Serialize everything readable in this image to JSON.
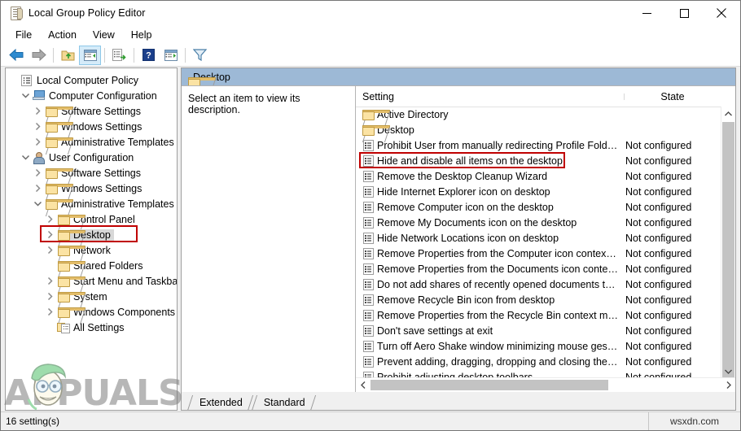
{
  "window": {
    "title": "Local Group Policy Editor",
    "icon": "policy-editor-icon",
    "controls": {
      "minimize": "—",
      "maximize": "□",
      "close": "✕"
    }
  },
  "menubar": {
    "items": [
      {
        "label": "File"
      },
      {
        "label": "Action"
      },
      {
        "label": "View"
      },
      {
        "label": "Help"
      }
    ]
  },
  "toolbar": {
    "buttons": [
      {
        "name": "back-button",
        "icon": "arrow-left-icon"
      },
      {
        "name": "forward-button",
        "icon": "arrow-right-icon"
      },
      {
        "name": "up-one-level-button",
        "icon": "folder-up-icon"
      },
      {
        "name": "show-hide-console-tree-button",
        "icon": "console-tree-icon"
      },
      {
        "name": "export-list-button",
        "icon": "export-list-icon"
      },
      {
        "name": "help-button",
        "icon": "question-mark-icon"
      },
      {
        "name": "show-hide-action-pane-button",
        "icon": "action-pane-icon"
      },
      {
        "name": "filter-button",
        "icon": "funnel-filter-icon"
      }
    ]
  },
  "tree": {
    "root": "Local Computer Policy",
    "nodes": [
      {
        "label": "Local Computer Policy",
        "indent": 0,
        "expander": "none",
        "icon": "policy-root-icon",
        "selected": false
      },
      {
        "label": "Computer Configuration",
        "indent": 1,
        "expander": "expanded",
        "icon": "computer-icon",
        "selected": false
      },
      {
        "label": "Software Settings",
        "indent": 2,
        "expander": "collapsed",
        "icon": "folder-icon",
        "selected": false
      },
      {
        "label": "Windows Settings",
        "indent": 2,
        "expander": "collapsed",
        "icon": "folder-icon",
        "selected": false
      },
      {
        "label": "Administrative Templates",
        "indent": 2,
        "expander": "collapsed",
        "icon": "folder-icon",
        "selected": false
      },
      {
        "label": "User Configuration",
        "indent": 1,
        "expander": "expanded",
        "icon": "user-icon",
        "selected": false
      },
      {
        "label": "Software Settings",
        "indent": 2,
        "expander": "collapsed",
        "icon": "folder-icon",
        "selected": false
      },
      {
        "label": "Windows Settings",
        "indent": 2,
        "expander": "collapsed",
        "icon": "folder-icon",
        "selected": false
      },
      {
        "label": "Administrative Templates",
        "indent": 2,
        "expander": "expanded",
        "icon": "folder-icon",
        "selected": false
      },
      {
        "label": "Control Panel",
        "indent": 3,
        "expander": "collapsed",
        "icon": "folder-icon",
        "selected": false
      },
      {
        "label": "Desktop",
        "indent": 3,
        "expander": "collapsed",
        "icon": "folder-icon",
        "selected": true
      },
      {
        "label": "Network",
        "indent": 3,
        "expander": "collapsed",
        "icon": "folder-icon",
        "selected": false
      },
      {
        "label": "Shared Folders",
        "indent": 3,
        "expander": "none",
        "icon": "folder-icon",
        "selected": false
      },
      {
        "label": "Start Menu and Taskbar",
        "indent": 3,
        "expander": "collapsed",
        "icon": "folder-icon",
        "selected": false
      },
      {
        "label": "System",
        "indent": 3,
        "expander": "collapsed",
        "icon": "folder-icon",
        "selected": false
      },
      {
        "label": "Windows Components",
        "indent": 3,
        "expander": "collapsed",
        "icon": "folder-icon",
        "selected": false
      },
      {
        "label": "All Settings",
        "indent": 3,
        "expander": "none",
        "icon": "all-settings-icon",
        "selected": false
      }
    ]
  },
  "right_pane": {
    "header_label": "Desktop",
    "header_icon": "folder-icon",
    "description": "Select an item to view its description.",
    "columns": {
      "setting": "Setting",
      "state": "State"
    },
    "rows": [
      {
        "name": "Active Directory",
        "state": "",
        "icon": "folder-icon",
        "highlighted": false
      },
      {
        "name": "Desktop",
        "state": "",
        "icon": "folder-icon",
        "highlighted": false
      },
      {
        "name": "Prohibit User from manually redirecting Profile Folders",
        "state": "Not configured",
        "icon": "policy-icon",
        "highlighted": false
      },
      {
        "name": "Hide and disable all items on the desktop",
        "state": "Not configured",
        "icon": "policy-icon",
        "highlighted": true
      },
      {
        "name": "Remove the Desktop Cleanup Wizard",
        "state": "Not configured",
        "icon": "policy-icon",
        "highlighted": false
      },
      {
        "name": "Hide Internet Explorer icon on desktop",
        "state": "Not configured",
        "icon": "policy-icon",
        "highlighted": false
      },
      {
        "name": "Remove Computer icon on the desktop",
        "state": "Not configured",
        "icon": "policy-icon",
        "highlighted": false
      },
      {
        "name": "Remove My Documents icon on the desktop",
        "state": "Not configured",
        "icon": "policy-icon",
        "highlighted": false
      },
      {
        "name": "Hide Network Locations icon on desktop",
        "state": "Not configured",
        "icon": "policy-icon",
        "highlighted": false
      },
      {
        "name": "Remove Properties from the Computer icon context menu",
        "state": "Not configured",
        "icon": "policy-icon",
        "highlighted": false
      },
      {
        "name": "Remove Properties from the Documents icon context menu",
        "state": "Not configured",
        "icon": "policy-icon",
        "highlighted": false
      },
      {
        "name": "Do not add shares of recently opened documents to Networ...",
        "state": "Not configured",
        "icon": "policy-icon",
        "highlighted": false
      },
      {
        "name": "Remove Recycle Bin icon from desktop",
        "state": "Not configured",
        "icon": "policy-icon",
        "highlighted": false
      },
      {
        "name": "Remove Properties from the Recycle Bin context menu",
        "state": "Not configured",
        "icon": "policy-icon",
        "highlighted": false
      },
      {
        "name": "Don't save settings at exit",
        "state": "Not configured",
        "icon": "policy-icon",
        "highlighted": false
      },
      {
        "name": "Turn off Aero Shake window minimizing mouse gesture",
        "state": "Not configured",
        "icon": "policy-icon",
        "highlighted": false
      },
      {
        "name": "Prevent adding, dragging, dropping and closing the Taskbar...",
        "state": "Not configured",
        "icon": "policy-icon",
        "highlighted": false
      },
      {
        "name": "Prohibit adjusting desktop toolbars",
        "state": "Not configured",
        "icon": "policy-icon",
        "highlighted": false
      }
    ]
  },
  "tabs": [
    {
      "label": "Extended",
      "active": false
    },
    {
      "label": "Standard",
      "active": true
    }
  ],
  "statusbar": {
    "left": "16 setting(s)",
    "right": "wsxdn.com"
  },
  "watermark": {
    "text": "APPUALS"
  },
  "colors": {
    "highlight_box": "#c00000",
    "pane_header": "#9db9d6",
    "selection": "#d8d8d8",
    "window_chrome": "#f0f0f0"
  }
}
